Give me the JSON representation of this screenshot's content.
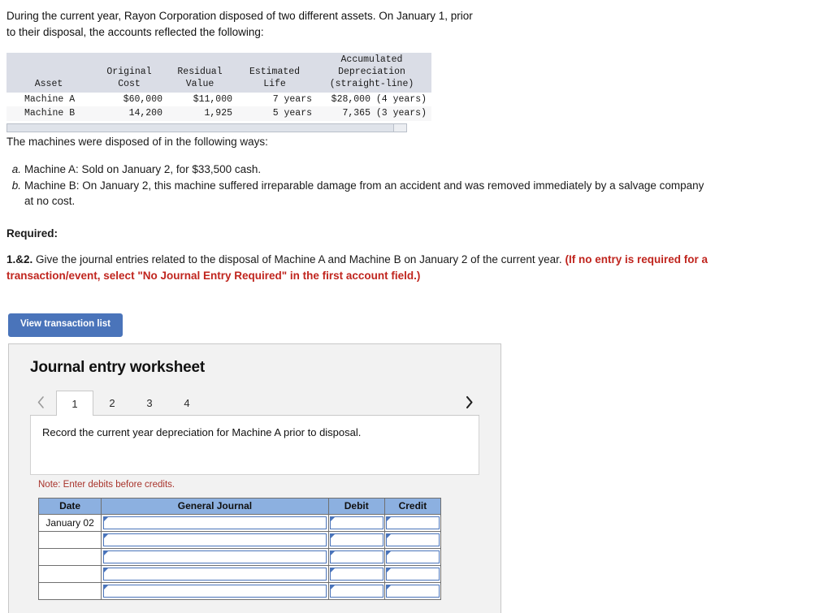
{
  "intro": {
    "paragraph": "During the current year, Rayon Corporation disposed of two different assets. On January 1, prior to their disposal, the accounts reflected the following:"
  },
  "asset_table": {
    "headers": {
      "asset": "Asset",
      "original_cost_l1": "Original",
      "original_cost_l2": "Cost",
      "residual_value_l1": "Residual",
      "residual_value_l2": "Value",
      "estimated_life_l1": "Estimated",
      "estimated_life_l2": "Life",
      "accumulated_l1": "Accumulated",
      "accumulated_l2": "Depreciation",
      "accumulated_l3": "(straight-line)"
    },
    "rows": [
      {
        "asset": "Machine A",
        "original_cost": "$60,000",
        "residual_value": "$11,000",
        "estimated_life": "7 years",
        "accumulated_depreciation": "$28,000 (4 years)"
      },
      {
        "asset": "Machine B",
        "original_cost": "14,200",
        "residual_value": "1,925",
        "estimated_life": "5 years",
        "accumulated_depreciation": "7,365 (3 years)"
      }
    ]
  },
  "body": {
    "disposed_intro": "The machines were disposed of in the following ways:",
    "items": [
      {
        "marker": "a.",
        "text": "Machine A: Sold on January 2, for $33,500 cash."
      },
      {
        "marker": "b.",
        "text": "Machine B: On January 2, this machine suffered irreparable damage from an accident and was removed immediately by a salvage company at no cost."
      }
    ],
    "required_heading": "Required:",
    "requirement_number": "1.&2.",
    "requirement_text": "Give the journal entries related to the disposal of Machine A and Machine B on January 2 of the current year.",
    "requirement_note": "(If no entry is required for a transaction/event, select \"No Journal Entry Required\" in the first account field.)"
  },
  "toolbar": {
    "view_transaction_list": "View transaction list"
  },
  "worksheet": {
    "title": "Journal entry worksheet",
    "prev_label": "‹",
    "next_label": "›",
    "tabs": [
      {
        "label": "1",
        "active": true
      },
      {
        "label": "2",
        "active": false
      },
      {
        "label": "3",
        "active": false
      },
      {
        "label": "4",
        "active": false
      }
    ],
    "instruction": "Record the current year depreciation for Machine A prior to disposal.",
    "note": "Note: Enter debits before credits.",
    "journal": {
      "columns": [
        "Date",
        "General Journal",
        "Debit",
        "Credit"
      ],
      "rows": [
        {
          "date": "January 02",
          "general_journal": "",
          "debit": "",
          "credit": ""
        },
        {
          "date": "",
          "general_journal": "",
          "debit": "",
          "credit": ""
        },
        {
          "date": "",
          "general_journal": "",
          "debit": "",
          "credit": ""
        },
        {
          "date": "",
          "general_journal": "",
          "debit": "",
          "credit": ""
        },
        {
          "date": "",
          "general_journal": "",
          "debit": "",
          "credit": ""
        }
      ]
    }
  },
  "colors": {
    "button_blue": "#4a74ba",
    "table_header_blue": "#8cb0e0",
    "note_red": "#a8332b",
    "requirement_red": "#c0251e",
    "data_header_gray": "#dadde6"
  }
}
